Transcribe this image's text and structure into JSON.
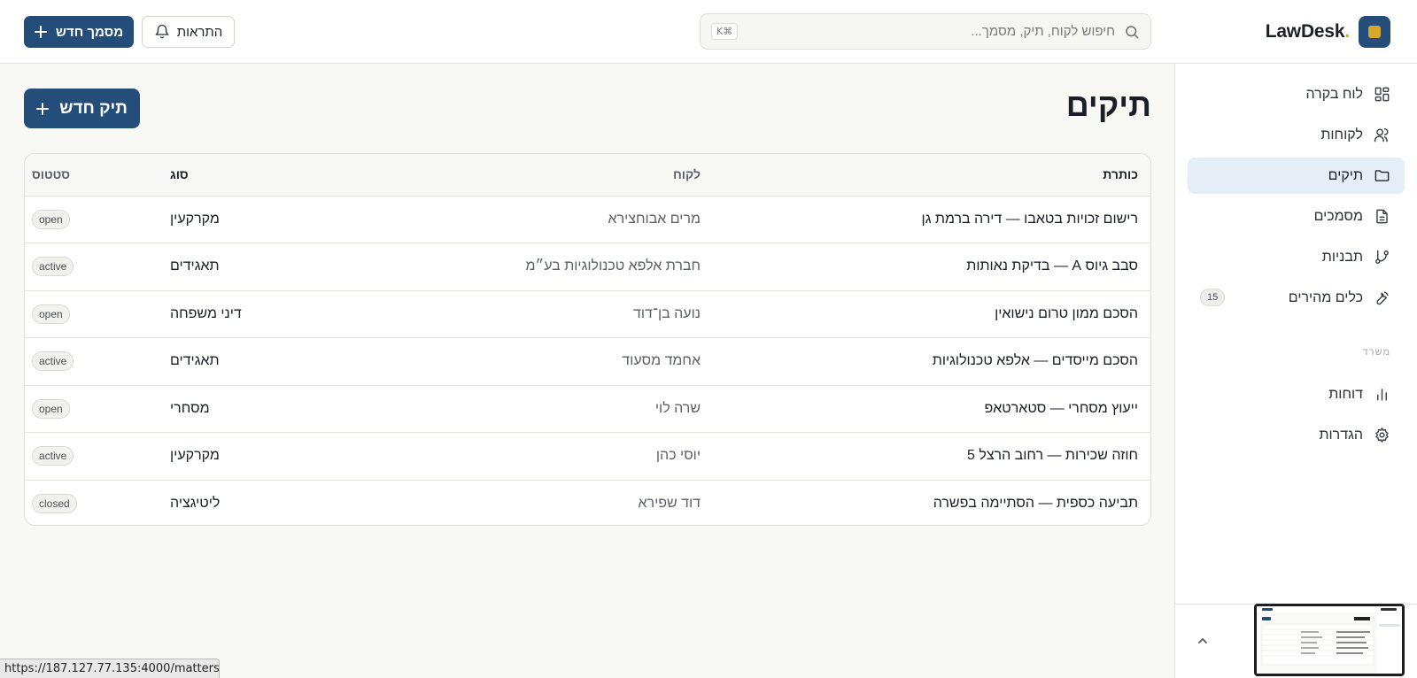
{
  "header": {
    "brand": "LawDesk",
    "brand_accent": ".",
    "search_placeholder": "חיפוש לקוח, תיק, מסמך...",
    "search_shortcut": "K⌘",
    "notifications_label": "התראות",
    "new_document_label": "מסמך חדש"
  },
  "sidebar": {
    "items": [
      {
        "label": "לוח בקרה",
        "icon": "dashboard-icon"
      },
      {
        "label": "לקוחות",
        "icon": "users-icon"
      },
      {
        "label": "תיקים",
        "icon": "folder-icon",
        "active": true
      },
      {
        "label": "מסמכים",
        "icon": "document-icon"
      },
      {
        "label": "תבניות",
        "icon": "git-branch-icon"
      },
      {
        "label": "כלים מהירים",
        "icon": "wrench-icon",
        "badge": "15"
      }
    ],
    "section_label": "משרד",
    "office_items": [
      {
        "label": "דוחות",
        "icon": "bar-chart-icon"
      },
      {
        "label": "הגדרות",
        "icon": "settings-icon"
      }
    ]
  },
  "main": {
    "title": "תיקים",
    "new_case_label": "תיק חדש",
    "table": {
      "columns": {
        "title": "כותרת",
        "client": "לקוח",
        "type": "סוג",
        "status": "סטטוס"
      },
      "rows": [
        {
          "title": "רישום זכויות בטאבו — דירה ברמת גן",
          "client": "מרים אבוחצירא",
          "type": "מקרקעין",
          "status": "open"
        },
        {
          "title": "סבב גיוס A — בדיקת נאותות",
          "client": "חברת אלפא טכנולוגיות בע״מ",
          "type": "תאגידים",
          "status": "active"
        },
        {
          "title": "הסכם ממון טרום נישואין",
          "client": "נועה בן־דוד",
          "type": "דיני משפחה",
          "status": "open"
        },
        {
          "title": "הסכם מייסדים — אלפא טכנולוגיות",
          "client": "אחמד מסעוד",
          "type": "תאגידים",
          "status": "active"
        },
        {
          "title": "ייעוץ מסחרי — סטארטאפ",
          "client": "שרה לוי",
          "type": "מסחרי",
          "status": "open"
        },
        {
          "title": "חוזה שכירות — רחוב הרצל 5",
          "client": "יוסי כהן",
          "type": "מקרקעין",
          "status": "active"
        },
        {
          "title": "תביעה כספית — הסתיימה בפשרה",
          "client": "דוד שפירא",
          "type": "ליטיגציה",
          "status": "closed"
        }
      ]
    }
  },
  "status_url": "https://187.127.77.135:4000/matters",
  "colors": {
    "primary": "#244d79",
    "accent": "#d6a72a",
    "active_nav_bg": "#e5edf6",
    "page_bg": "#f8f8f5"
  }
}
